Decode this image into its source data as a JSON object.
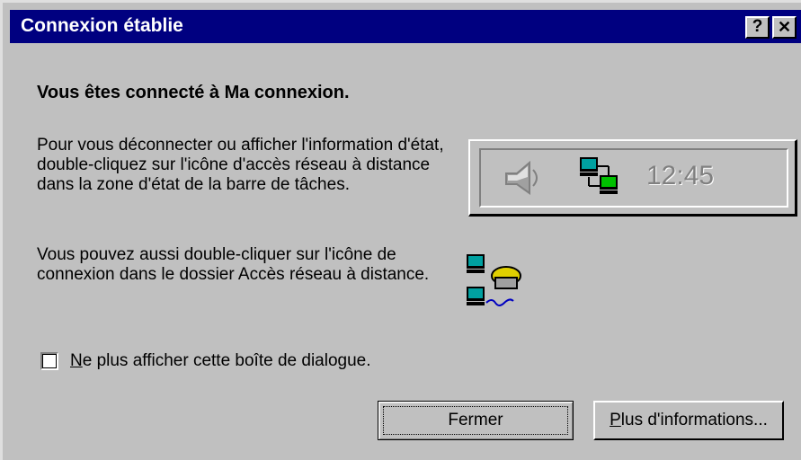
{
  "window": {
    "title": "Connexion établie",
    "help_label": "?",
    "close_label": "✕"
  },
  "content": {
    "heading": "Vous êtes connecté à Ma connexion.",
    "paragraph1": "Pour vous déconnecter ou afficher l'information d'état, double-cliquez sur l'icône d'accès réseau à distance dans la zone d'état de la barre de tâches.",
    "paragraph2": "Vous pouvez aussi double-cliquer sur l'icône de connexion dans le dossier Accès réseau à distance.",
    "tray": {
      "clock": "12:45",
      "icons": [
        "speaker-icon",
        "network-connection-icon"
      ]
    },
    "connection_icon": "dialup-connection-icon"
  },
  "options": {
    "dont_show_label_first": "N",
    "dont_show_label_rest": "e plus afficher cette boîte de dialogue.",
    "dont_show_checked": false
  },
  "buttons": {
    "close": "Fermer",
    "more_info_first": "P",
    "more_info_rest": "lus d'informations..."
  }
}
